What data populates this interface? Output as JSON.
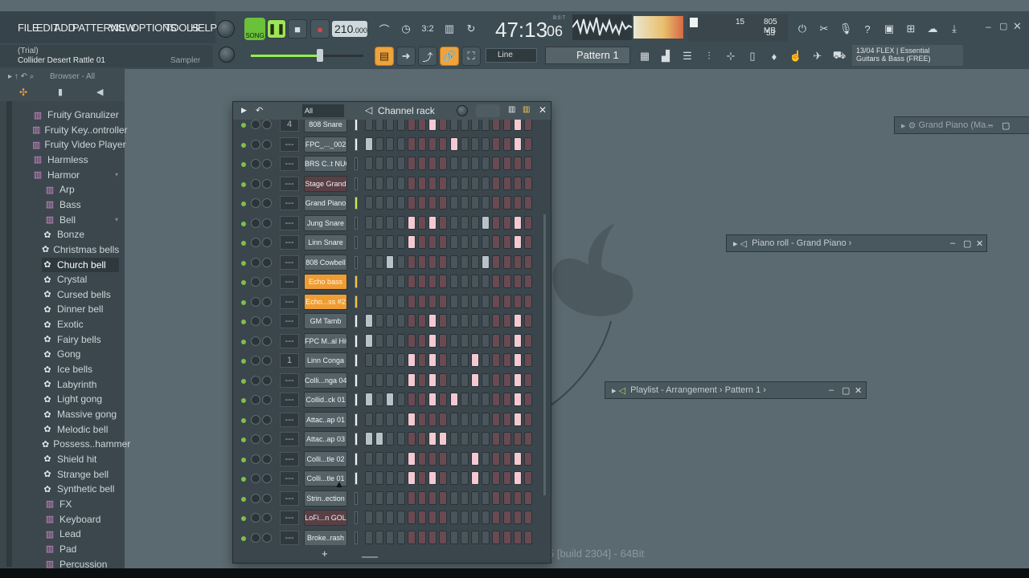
{
  "menu": [
    "FILE",
    "EDIT",
    "ADD",
    "PATTERNS",
    "VIEW",
    "OPTIONS",
    "TOOLS",
    "HELP"
  ],
  "trial": "(Trial)",
  "hint_name": "Collider Desert Rattle 01",
  "hint_type": "Sampler",
  "song_label": "SONG",
  "tempo": "210",
  "tempo_frac": ".000",
  "time_main": "47:13",
  "time_sub": "06",
  "time_small": "B:S:T",
  "cpu_label": "15",
  "mem_label": "805 MB",
  "poly_label": "53",
  "snap_label": "Line",
  "pattern_label": "Pattern 1",
  "news_date": "13/04",
  "news_title": "FLEX | Essential",
  "news_sub": "Guitars & Bass (FREE)",
  "browser_label": "Browser - All",
  "browser_items": [
    {
      "label": "Fruity Granulizer",
      "icon": "plugin",
      "indent": 1
    },
    {
      "label": "Fruity Key..ontroller",
      "icon": "plugin",
      "indent": 1
    },
    {
      "label": "Fruity Video Player",
      "icon": "plugin",
      "indent": 1
    },
    {
      "label": "Harmless",
      "icon": "plugin",
      "indent": 1
    },
    {
      "label": "Harmor",
      "icon": "plugin",
      "indent": 1,
      "open": true
    },
    {
      "label": "Arp",
      "icon": "folder",
      "indent": 2
    },
    {
      "label": "Bass",
      "icon": "folder",
      "indent": 2
    },
    {
      "label": "Bell",
      "icon": "folder",
      "indent": 2,
      "open": true
    },
    {
      "label": "Bonze",
      "icon": "preset",
      "indent": 2
    },
    {
      "label": "Christmas bells",
      "icon": "preset",
      "indent": 2
    },
    {
      "label": "Church bell",
      "icon": "preset",
      "indent": 2,
      "selected": true
    },
    {
      "label": "Crystal",
      "icon": "preset",
      "indent": 2
    },
    {
      "label": "Cursed bells",
      "icon": "preset",
      "indent": 2
    },
    {
      "label": "Dinner bell",
      "icon": "preset",
      "indent": 2
    },
    {
      "label": "Exotic",
      "icon": "preset",
      "indent": 2
    },
    {
      "label": "Fairy bells",
      "icon": "preset",
      "indent": 2
    },
    {
      "label": "Gong",
      "icon": "preset",
      "indent": 2
    },
    {
      "label": "Ice bells",
      "icon": "preset",
      "indent": 2
    },
    {
      "label": "Labyrinth",
      "icon": "preset",
      "indent": 2
    },
    {
      "label": "Light gong",
      "icon": "preset",
      "indent": 2
    },
    {
      "label": "Massive gong",
      "icon": "preset",
      "indent": 2
    },
    {
      "label": "Melodic bell",
      "icon": "preset",
      "indent": 2
    },
    {
      "label": "Possess..hammer",
      "icon": "preset",
      "indent": 2
    },
    {
      "label": "Shield hit",
      "icon": "preset",
      "indent": 2
    },
    {
      "label": "Strange bell",
      "icon": "preset",
      "indent": 2
    },
    {
      "label": "Synthetic bell",
      "icon": "preset",
      "indent": 2
    },
    {
      "label": "FX",
      "icon": "folder",
      "indent": 2
    },
    {
      "label": "Keyboard",
      "icon": "folder",
      "indent": 2
    },
    {
      "label": "Lead",
      "icon": "folder",
      "indent": 2
    },
    {
      "label": "Pad",
      "icon": "folder",
      "indent": 2
    },
    {
      "label": "Percussion",
      "icon": "folder",
      "indent": 2
    }
  ],
  "rack": {
    "title": "Channel rack",
    "filter": "All",
    "add": "+",
    "channels": [
      {
        "num": "4",
        "name": "808 Snare",
        "style": "",
        "sel": "white",
        "steps": [
          6,
          14
        ]
      },
      {
        "num": "---",
        "name": "FPC_..._002",
        "style": "",
        "sel": "white",
        "steps": [
          0,
          8,
          14
        ]
      },
      {
        "num": "---",
        "name": "BRS C..t NUC",
        "style": "",
        "sel": "",
        "steps": []
      },
      {
        "num": "---",
        "name": "Stage Grand",
        "style": "dark",
        "sel": "",
        "steps": []
      },
      {
        "num": "---",
        "name": "Grand Piano",
        "style": "",
        "sel": "green",
        "steps": []
      },
      {
        "num": "---",
        "name": "Jung Snare",
        "style": "",
        "sel": "",
        "steps": [
          4,
          6,
          11,
          14
        ]
      },
      {
        "num": "---",
        "name": "Linn Snare",
        "style": "",
        "sel": "",
        "steps": [
          4,
          14
        ]
      },
      {
        "num": "---",
        "name": "808 Cowbell",
        "style": "",
        "sel": "",
        "steps": [
          2,
          11
        ]
      },
      {
        "num": "---",
        "name": "Echo bass",
        "style": "orange",
        "sel": "orange",
        "steps": []
      },
      {
        "num": "---",
        "name": "Echo...ss #2",
        "style": "orange",
        "sel": "orange",
        "steps": []
      },
      {
        "num": "---",
        "name": "GM Tamb",
        "style": "",
        "sel": "white",
        "steps": [
          0,
          6,
          14
        ]
      },
      {
        "num": "---",
        "name": "FPC M..al Hit",
        "style": "",
        "sel": "white",
        "steps": [
          0,
          6,
          14,
          16
        ]
      },
      {
        "num": "1",
        "name": "Linn Conga",
        "style": "",
        "sel": "white",
        "steps": [
          4,
          6,
          10,
          14
        ]
      },
      {
        "num": "---",
        "name": "Colli...nga 04",
        "style": "",
        "sel": "white",
        "steps": [
          4,
          6,
          10,
          14,
          16
        ]
      },
      {
        "num": "---",
        "name": "Collid..ck 01",
        "style": "",
        "sel": "white",
        "steps": [
          0,
          2,
          6,
          8,
          14
        ]
      },
      {
        "num": "---",
        "name": "Attac..ap 01",
        "style": "",
        "sel": "white",
        "steps": [
          4,
          14
        ]
      },
      {
        "num": "---",
        "name": "Attac..ap 03",
        "style": "",
        "sel": "white",
        "steps": [
          0,
          1,
          6,
          7
        ]
      },
      {
        "num": "---",
        "name": "Colli...tle 02",
        "style": "",
        "sel": "white",
        "steps": [
          4,
          10,
          14
        ]
      },
      {
        "num": "---",
        "name": "Colli...tle 01",
        "style": "",
        "sel": "white",
        "steps": [
          4,
          6,
          10,
          14
        ]
      },
      {
        "num": "---",
        "name": "Strin..ection",
        "style": "",
        "sel": "",
        "steps": []
      },
      {
        "num": "---",
        "name": "LoFi...n GOL",
        "style": "dark",
        "sel": "",
        "steps": []
      },
      {
        "num": "---",
        "name": "Broke..rash",
        "style": "",
        "sel": "",
        "steps": []
      }
    ]
  },
  "windows": {
    "grand_piano": "Grand Piano (Ma...",
    "piano_roll": "Piano roll - Grand Piano",
    "playlist": "Playlist - Arrangement",
    "playlist_pattern": "Pattern 1"
  },
  "build": "5 [build 2304] - 64Bit"
}
